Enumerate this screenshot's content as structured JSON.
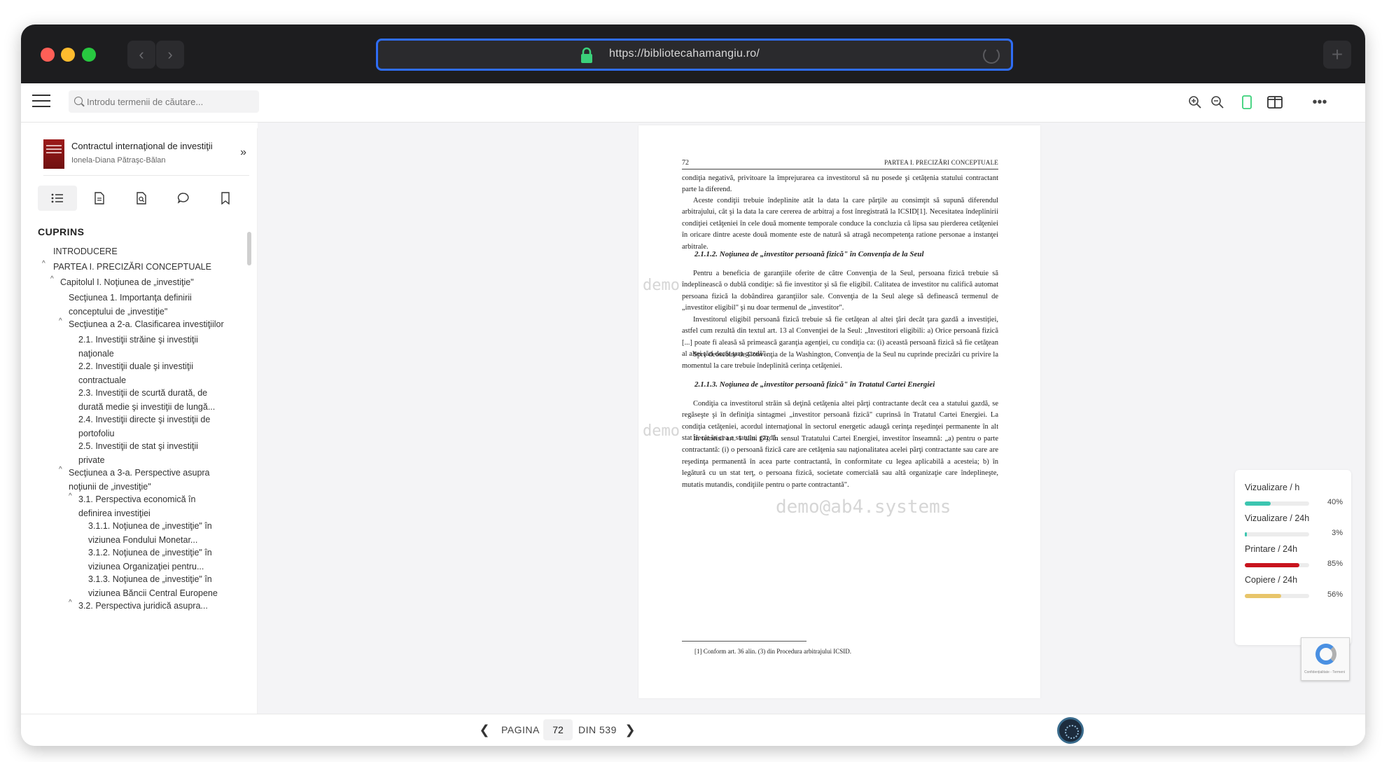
{
  "browser": {
    "url": "https://bibliotecahamangiu.ro/",
    "back_icon": "chevron-left-icon",
    "forward_icon": "chevron-right-icon"
  },
  "toolbar": {
    "search_placeholder": "Introdu termenii de căutare..."
  },
  "book": {
    "title": "Contractul internaţional de investiţii",
    "author": "Ionela-Diana Pătraşc-Bălan"
  },
  "sidebar": {
    "section_title": "CUPRINS",
    "toc": [
      "INTRODUCERE",
      "PARTEA I. PRECIZĂRI CONCEPTUALE",
      "Capitolul I. Noţiunea de „investiţie\"",
      "Secţiunea 1. Importanţa definirii conceptului de „investiţie\"",
      "Secţiunea a 2-a. Clasificarea investiţiilor",
      "2.1. Investiţii străine şi investiţii naţionale",
      "2.2. Investiţii duale şi investiţii contractuale",
      "2.3. Investiţii de scurtă durată, de durată medie şi investiţii de lungă...",
      "2.4. Investiţii directe şi investiţii de portofoliu",
      "2.5. Investiţii de stat şi investiţii private",
      "Secţiunea a 3-a. Perspective asupra noţiunii de „investiţie\"",
      "3.1. Perspectiva economică în definirea investiţiei",
      "3.1.1. Noţiunea de „investiţie\" în viziunea Fondului Monetar...",
      "3.1.2. Noţiunea de „investiţie\" în viziunea Organizaţiei pentru...",
      "3.1.3. Noţiunea de „investiţie\" în viziunea Băncii Central Europene",
      "3.2. Perspectiva juridică asupra..."
    ]
  },
  "document": {
    "page_number": "72",
    "running_header": "PARTEA I. PRECIZĂRI CONCEPTUALE",
    "paragraphs": [
      "condiţia negativă, privitoare la împrejurarea ca investitorul să nu posede şi cetăţenia statului contractant parte la diferend.",
      "Aceste condiţii trebuie îndeplinite atât la data la care părţile au consimţit să supună diferendul arbitrajului, cât şi la data la care cererea de arbitraj a fost înregistrată la ICSID[1]. Necesitatea îndeplinirii condiţiei cetăţeniei în cele două momente temporale conduce la concluzia că lipsa sau pierderea cetăţeniei în oricare dintre aceste două momente este de natură să atragă necompetenţa ratione personae a instanţei arbitrale.",
      "2.1.1.2. Noţiunea de „investitor persoană fizică\" în Convenţia de la Seul",
      "Pentru a beneficia de garanţiile oferite de către Convenţia de la Seul, persoana fizică trebuie să îndeplinească o dublă condiţie: să fie investitor şi să fie eligibil. Calitatea de investitor nu califică automat persoana fizică la dobândirea garanţiilor sale. Convenţia de la Seul alege să definească termenul de „investitor eligibil\" şi nu doar termenul de „investitor\".",
      "Investitorul eligibil persoană fizică trebuie să fie cetăţean al altei ţări decât ţara gazdă a investiţiei, astfel cum rezultă din textul art. 13 al Convenţiei de la Seul: „Investitori eligibili: a) Orice persoană fizică [...] poate fi aleasă să primească garanţia agenţiei, cu condiţia ca: (i) această persoană fizică să fie cetăţean al altei ţări decât ţara gazdă\".",
      "Spre deosebire de Convenţia de la Washington, Convenţia de la Seul nu cuprinde precizări cu privire la momentul la care trebuie îndeplinită cerinţa cetăţeniei.",
      "2.1.1.3. Noţiunea de „investitor persoană fizică\" în Tratatul Cartei Energiei",
      "Condiţia ca investitorul străin să deţină cetăţenia altei părţi contractante decât cea a statului gazdă, se regăseşte şi în definiţia sintagmei „investitor persoană fizică\" cuprinsă în Tratatul Cartei Energiei. La condiţia cetăţeniei, acordul internaţional în sectorul energetic adaugă cerinţa reşedinţei permanente în alt stat decât în cea a statului gazdă.",
      "În temeiul art. 1 alin. (7), în sensul Tratatului Cartei Energiei, investitor înseamnă: „a) pentru o parte contractantă: (i) o persoană fizică care are cetăţenia sau naţionalitatea acelei părţi contractante sau care are reşedinţa permanentă în acea parte contractantă, în conformitate cu legea aplicabilă a acesteia; b) în legătură cu un stat terţ, o persoana fizică, societate comercială sau altă organizaţie care îndeplineşte, mutatis mutandis, condiţiile pentru o parte contractantă\"."
    ],
    "footnote": "[1] Conform art. 36 alin. (3) din Procedura arbitrajului ICSID.",
    "watermark": "demo@ab4.systems",
    "watermark_fragment": "demo"
  },
  "stats": [
    {
      "label": "Vizualizare / h",
      "value": "40%",
      "fraction": 0.4,
      "color": "#3cc5b0"
    },
    {
      "label": "Vizualizare / 24h",
      "value": "3%",
      "fraction": 0.03,
      "color": "#3cc5b0"
    },
    {
      "label": "Printare / 24h",
      "value": "85%",
      "fraction": 0.85,
      "color": "#c8141e"
    },
    {
      "label": "Copiere / 24h",
      "value": "56%",
      "fraction": 0.56,
      "color": "#e8c56a"
    }
  ],
  "pagination": {
    "label_page": "PAGINA",
    "current": "72",
    "label_of": "DIN 539"
  },
  "recaptcha": {
    "text": "Confidențialitate - Termeni"
  },
  "colors": {
    "accent_blue": "#2f6df6",
    "lock_green": "#3bd17a"
  }
}
